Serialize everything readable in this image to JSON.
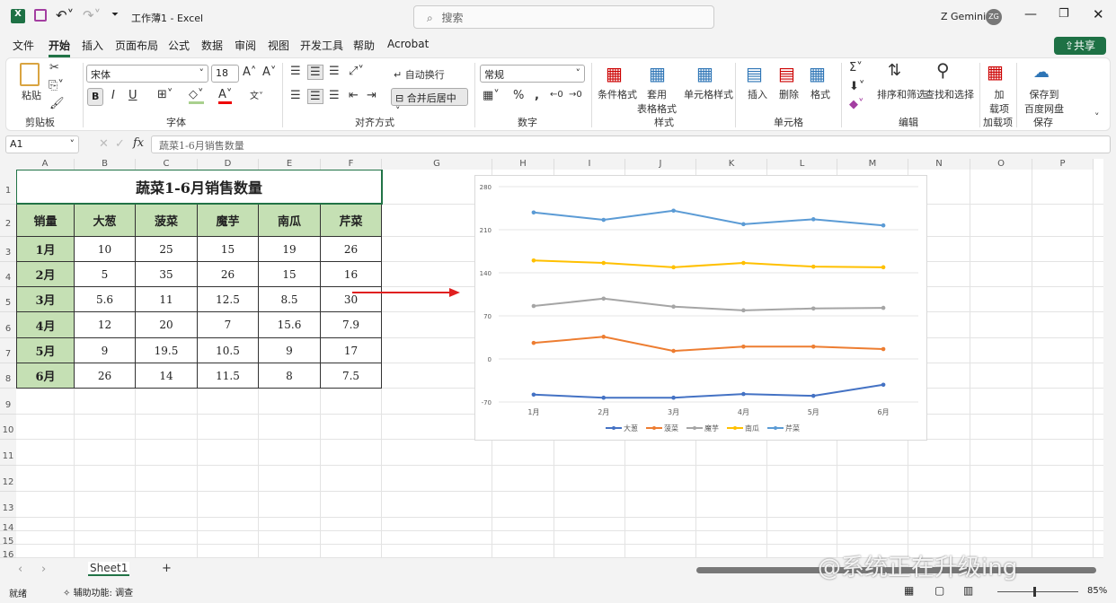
{
  "app": {
    "title": "工作薄1 - Excel",
    "search_placeholder": "搜索",
    "user": "Z Gemini",
    "user_initials": "ZG",
    "share": "共享"
  },
  "menu": [
    "文件",
    "开始",
    "插入",
    "页面布局",
    "公式",
    "数据",
    "审阅",
    "视图",
    "开发工具",
    "帮助",
    "Acrobat"
  ],
  "ribbon": {
    "clipboard": {
      "paste": "粘贴",
      "group": "剪贴板"
    },
    "font": {
      "name": "宋体",
      "size": "18",
      "group": "字体",
      "bold": "B",
      "italic": "I",
      "underline": "U"
    },
    "alignment": {
      "wrap": "自动换行",
      "merge": "合并后居中",
      "group": "对齐方式"
    },
    "number": {
      "format": "常规",
      "group": "数字"
    },
    "styles": {
      "conditional": "条件格式",
      "table": "套用\n表格格式",
      "cell": "单元格样式",
      "group": "样式"
    },
    "cells": {
      "insert": "插入",
      "delete": "删除",
      "format": "格式",
      "group": "单元格"
    },
    "editing": {
      "sort": "排序和筛选",
      "find": "查找和选择",
      "group": "编辑"
    },
    "addins": {
      "label": "加\n载项",
      "group": "加载项"
    },
    "save": {
      "label": "保存到\n百度网盘",
      "group": "保存"
    }
  },
  "formula_bar": {
    "cell_ref": "A1",
    "fx": "fx",
    "value": "蔬菜1-6月销售数量"
  },
  "columns": [
    "A",
    "B",
    "C",
    "D",
    "E",
    "F",
    "G",
    "H",
    "I",
    "J",
    "K",
    "L",
    "M",
    "N",
    "O",
    "P"
  ],
  "rows": [
    "1",
    "2",
    "3",
    "4",
    "5",
    "6",
    "7",
    "8",
    "9",
    "10",
    "11",
    "12",
    "13",
    "14",
    "15",
    "16"
  ],
  "table": {
    "title": "蔬菜1-6月销售数量",
    "headers": [
      "销量",
      "大葱",
      "菠菜",
      "魔芋",
      "南瓜",
      "芹菜"
    ],
    "rows": [
      [
        "1月",
        "10",
        "25",
        "15",
        "19",
        "26"
      ],
      [
        "2月",
        "5",
        "35",
        "26",
        "15",
        "16"
      ],
      [
        "3月",
        "5.6",
        "11",
        "12.5",
        "8.5",
        "30"
      ],
      [
        "4月",
        "12",
        "20",
        "7",
        "15.6",
        "7.9"
      ],
      [
        "5月",
        "9",
        "19.5",
        "10.5",
        "9",
        "17"
      ],
      [
        "6月",
        "26",
        "14",
        "11.5",
        "8",
        "7.5"
      ]
    ]
  },
  "chart_data": {
    "type": "line",
    "categories": [
      "1月",
      "2月",
      "3月",
      "4月",
      "5月",
      "6月"
    ],
    "ylim": [
      -70,
      280
    ],
    "yticks": [
      "280",
      "210",
      "140",
      "70",
      "0",
      "-70"
    ],
    "grid": true,
    "legend": "bottom",
    "series": [
      {
        "name": "大葱",
        "color": "#4472c4",
        "values": [
          -58,
          -63,
          -63,
          -57,
          -60,
          -42
        ]
      },
      {
        "name": "菠菜",
        "color": "#ed7d31",
        "values": [
          26,
          36,
          13,
          20,
          20,
          16
        ]
      },
      {
        "name": "魔芋",
        "color": "#a5a5a5",
        "values": [
          86,
          98,
          85,
          79,
          82,
          83
        ]
      },
      {
        "name": "南瓜",
        "color": "#ffc000",
        "values": [
          160,
          156,
          149,
          156,
          150,
          149
        ]
      },
      {
        "name": "芹菜",
        "color": "#5b9bd5",
        "values": [
          238,
          226,
          241,
          219,
          227,
          217
        ]
      }
    ]
  },
  "sheet_tabs": {
    "active": "Sheet1",
    "add": "+"
  },
  "status": {
    "ready": "就绪",
    "accessibility": "辅助功能: 调查",
    "zoom": "85%"
  },
  "watermark": "@系统正在升级ing"
}
